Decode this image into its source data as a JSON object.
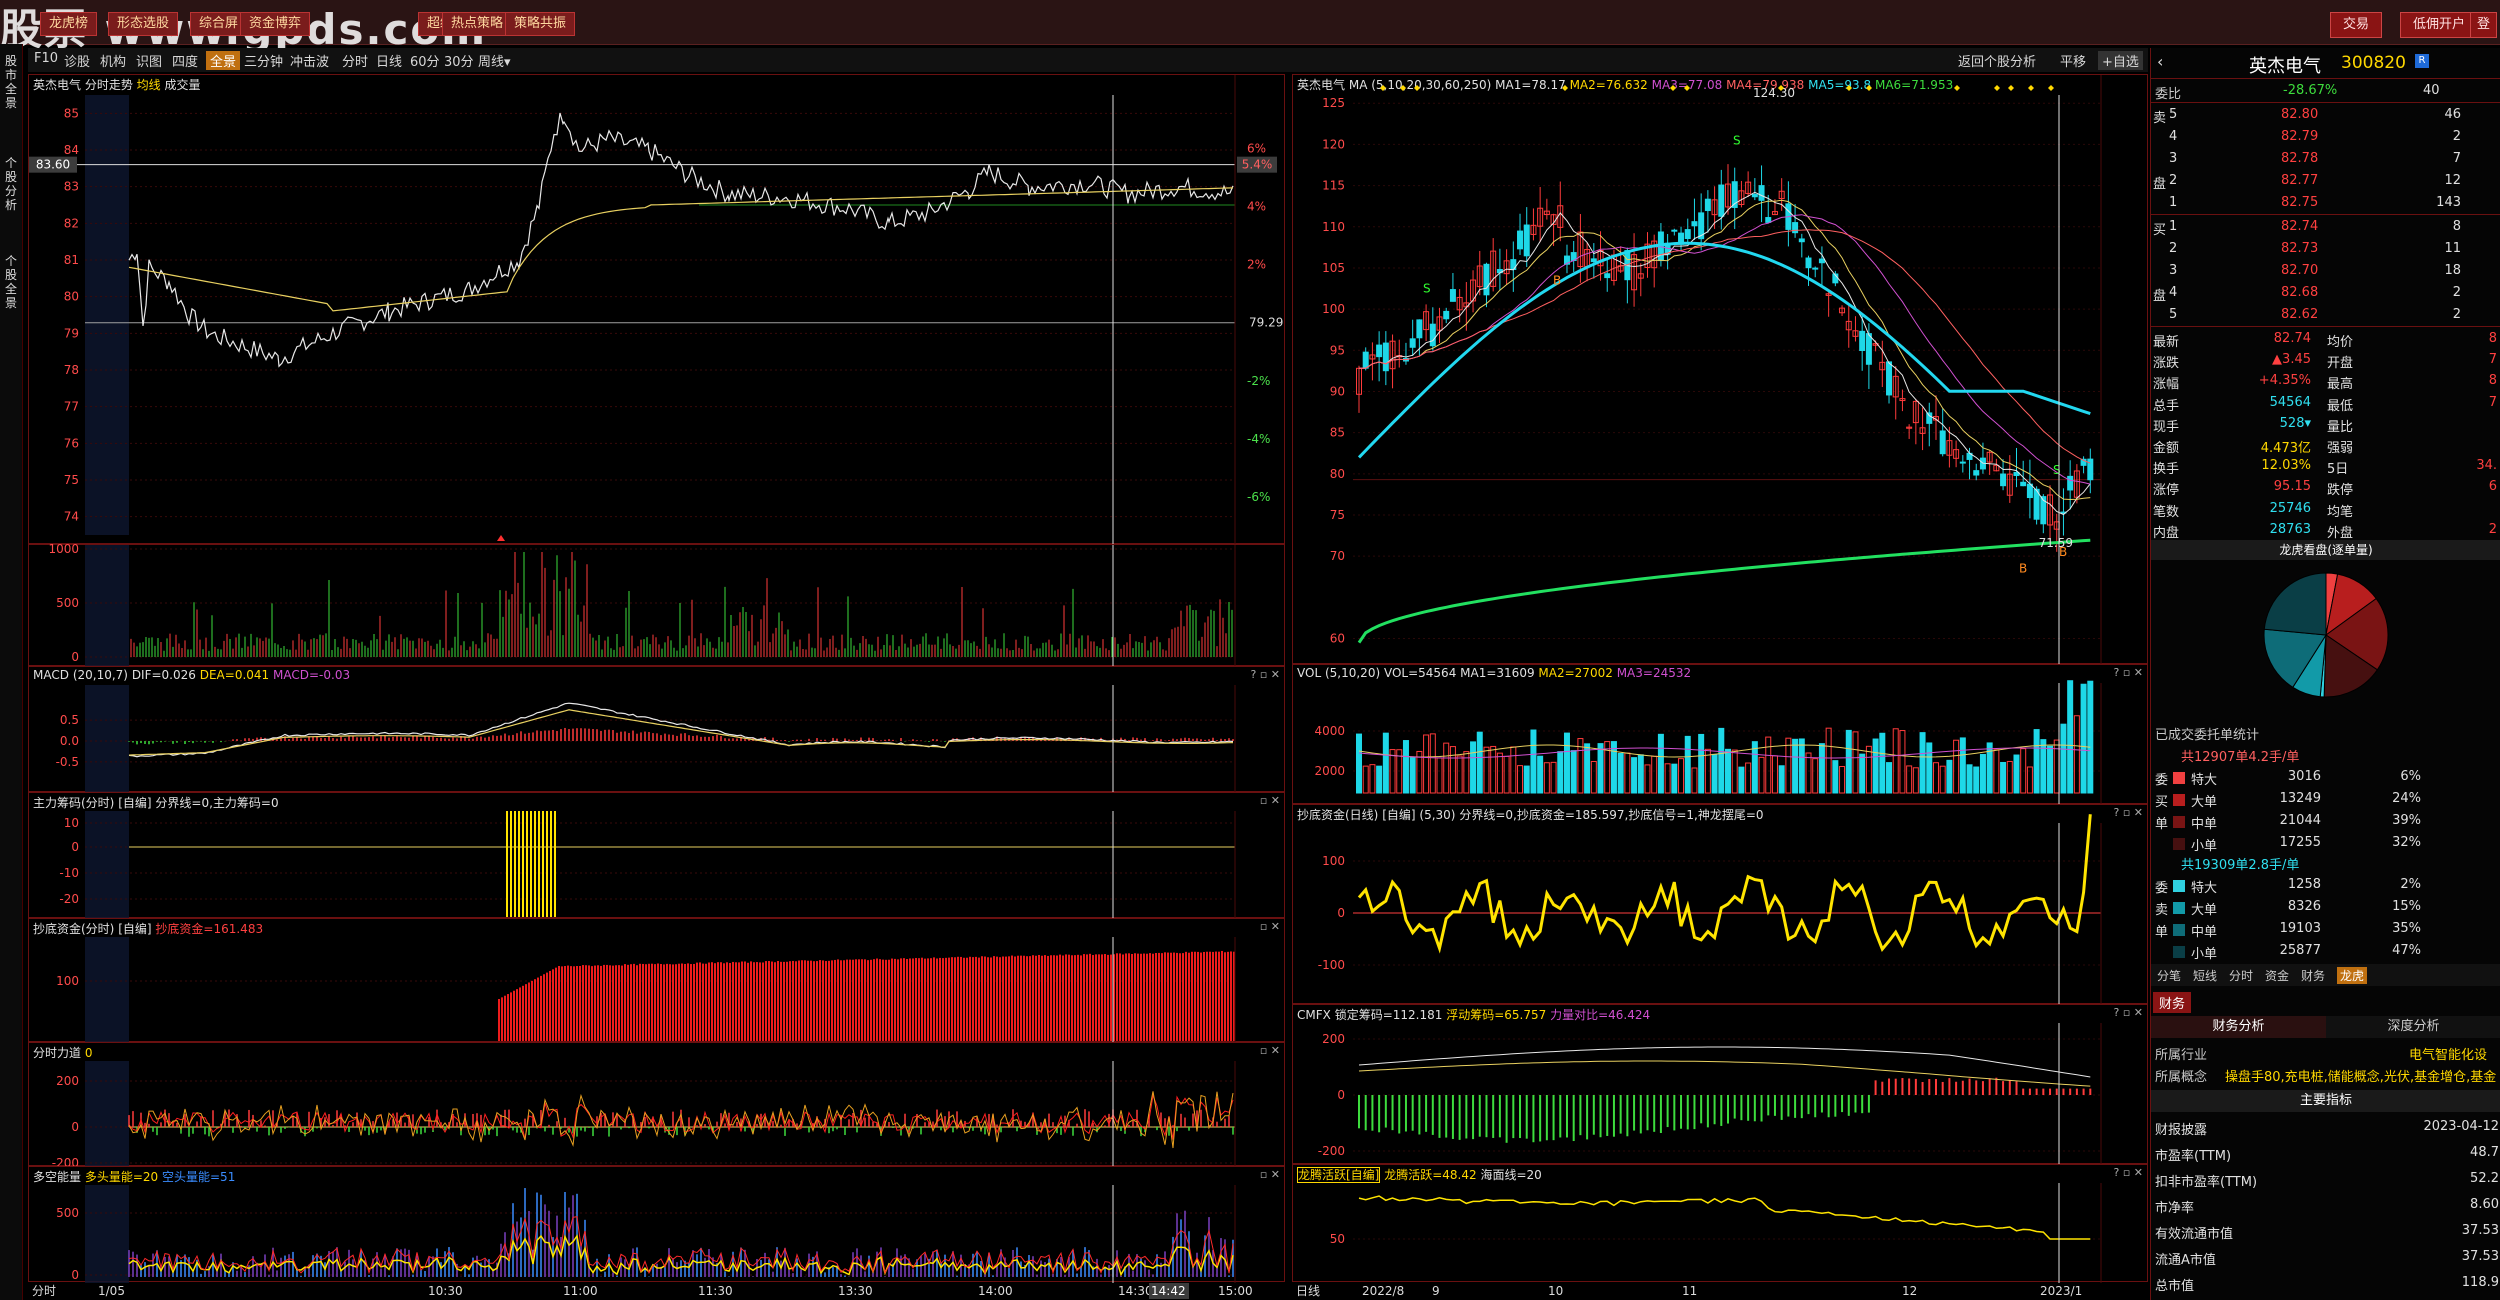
{
  "watermark": "股票 www.gpds.com",
  "top_buttons": [
    "龙虎榜",
    "形态选股",
    "综合屏",
    "资金博弈",
    "超级选股",
    "热点策略",
    "策略共振"
  ],
  "top_right": {
    "trade": "交易",
    "open_account": "低佣开户",
    "login": "登"
  },
  "side_tabs": [
    "股市全景",
    "个股分析",
    "个股全景"
  ],
  "toolbar": {
    "left": [
      "F10",
      "诊股",
      "机构",
      "识图",
      "四度",
      "全景",
      "三分钟",
      "冲击波",
      "分时",
      "日线",
      "60分",
      "30分",
      "周线▾"
    ],
    "active": "全景",
    "right": {
      "back": "返回个股分析",
      "flat": "平移",
      "self_select": "+自选"
    }
  },
  "intraday": {
    "title": "英杰电气  分时走势",
    "avg_label": "均线",
    "vol_label": "成交量",
    "price_ticks": [
      "85",
      "84",
      "83",
      "82",
      "81",
      "80",
      "79",
      "78",
      "77",
      "76",
      "75",
      "74"
    ],
    "pct_ticks": [
      "6%",
      "4%",
      "2%",
      "-2%",
      "-4%",
      "-6%"
    ],
    "pct_zero": "79.29",
    "current_price": "83.60",
    "current_pct": "5.4%",
    "vol_ticks": [
      "1000",
      "500",
      "0"
    ],
    "time_ticks": [
      "分时",
      "1/05",
      "10:30",
      "11:00",
      "11:30",
      "13:30",
      "14:00",
      "14:30",
      "14:42",
      "15:00"
    ],
    "cursor_time": "14:42",
    "macd": {
      "name": "MACD",
      "params": "(20,10,7)",
      "dif": "DIF=0.026",
      "dea": "DEA=0.041",
      "macd": "MACD=-0.03"
    },
    "macd_ticks": [
      "0.5",
      "0.0",
      "-0.5"
    ],
    "main_force": {
      "name": "主力筹码(分时)",
      "custom": "[自编]",
      "text": "分界线=0,主力筹码=0",
      "ticks": [
        "10",
        "0",
        "-10",
        "-20"
      ]
    },
    "bottom_fund": {
      "name": "抄底资金(分时)",
      "custom": "[自编]",
      "text": "抄底资金=161.483",
      "ticks": [
        "100"
      ]
    },
    "force": {
      "name": "分时力道",
      "value": "0",
      "ticks": [
        "200",
        "0",
        "-200"
      ]
    },
    "energy": {
      "name": "多空能量",
      "long": "多头量能=20",
      "short": "空头量能=51",
      "ticks": [
        "500",
        "0"
      ]
    }
  },
  "kline": {
    "title": "英杰电气",
    "ma_label": "MA",
    "ma_params": "(5,10,20,30,60,250)",
    "ma_values": [
      "MA1=78.17",
      "MA2=76.632",
      "MA3=77.08",
      "MA4=79.938",
      "MA5=93.8",
      "MA6=71.953"
    ],
    "price_ticks": [
      "125",
      "120",
      "115",
      "110",
      "105",
      "100",
      "95",
      "90",
      "85",
      "80",
      "75",
      "70",
      "60"
    ],
    "high_mark": "124.30",
    "low_mark": "71.59",
    "vol": {
      "name": "VOL",
      "params": "(5,10,20)",
      "values": [
        "VOL=54564",
        "MA1=31609",
        "MA2=27002",
        "MA3=24532"
      ],
      "ticks": [
        "4000",
        "2000"
      ]
    },
    "bottom_fund": {
      "name": "抄底资金(日线)",
      "custom": "[自编]",
      "params": "(5,30)",
      "text": "分界线=0,抄底资金=185.597,抄底信号=1,神龙摆尾=0",
      "ticks": [
        "100",
        "0",
        "-100"
      ]
    },
    "cmfx": {
      "name": "CMFX",
      "values": [
        "锁定筹码=112.181",
        "浮动筹码=65.757",
        "力量对比=46.424"
      ],
      "ticks": [
        "200",
        "0",
        "-200"
      ]
    },
    "dragon": {
      "name": "龙腾活跃[自编]",
      "text": "龙腾活跃=48.42",
      "sea": "海面线=20",
      "ticks": [
        "50"
      ]
    },
    "date_ticks": [
      "日线",
      "2022/8",
      "9",
      "10",
      "11",
      "12",
      "2023/1"
    ]
  },
  "quote": {
    "name": "英杰电气",
    "code": "300820",
    "ratio_label": "委比",
    "ratio_value": "-28.67%",
    "ratio_count": "40",
    "asks": [
      {
        "side": "卖",
        "n": "5",
        "price": "82.80",
        "vol": "46"
      },
      {
        "side": "",
        "n": "4",
        "price": "82.79",
        "vol": "2"
      },
      {
        "side": "",
        "n": "3",
        "price": "82.78",
        "vol": "7"
      },
      {
        "side": "盘",
        "n": "2",
        "price": "82.77",
        "vol": "12"
      },
      {
        "side": "",
        "n": "1",
        "price": "82.75",
        "vol": "143"
      }
    ],
    "bids": [
      {
        "side": "买",
        "n": "1",
        "price": "82.74",
        "vol": "8"
      },
      {
        "side": "",
        "n": "2",
        "price": "82.73",
        "vol": "11"
      },
      {
        "side": "",
        "n": "3",
        "price": "82.70",
        "vol": "18"
      },
      {
        "side": "盘",
        "n": "4",
        "price": "82.68",
        "vol": "2"
      },
      {
        "side": "",
        "n": "5",
        "price": "82.62",
        "vol": "2"
      }
    ],
    "stats_left": [
      {
        "k": "最新",
        "v": "82.74"
      },
      {
        "k": "涨跌",
        "v": "▲3.45"
      },
      {
        "k": "涨幅",
        "v": "+4.35%"
      },
      {
        "k": "总手",
        "v": "54564"
      },
      {
        "k": "现手",
        "v": "528▾"
      },
      {
        "k": "金额",
        "v": "4.473亿"
      },
      {
        "k": "换手",
        "v": "12.03%"
      },
      {
        "k": "涨停",
        "v": "95.15"
      },
      {
        "k": "笔数",
        "v": "25746"
      },
      {
        "k": "内盘",
        "v": "28763"
      }
    ],
    "stats_right": [
      {
        "k": "均价",
        "v": "8"
      },
      {
        "k": "开盘",
        "v": "7"
      },
      {
        "k": "最高",
        "v": "8"
      },
      {
        "k": "最低",
        "v": "7"
      },
      {
        "k": "量比",
        "v": ""
      },
      {
        "k": "强弱",
        "v": ""
      },
      {
        "k": "5日",
        "v": "34."
      },
      {
        "k": "跌停",
        "v": "6"
      },
      {
        "k": "均笔",
        "v": ""
      },
      {
        "k": "外盘",
        "v": "2"
      }
    ],
    "dragon_title": "龙虎看盘(逐单量)",
    "pie_slices": [
      {
        "pct": 6,
        "color": "#f04040"
      },
      {
        "pct": 24,
        "color": "#b81e1e"
      },
      {
        "pct": 39,
        "color": "#7a1414"
      },
      {
        "pct": 32,
        "color": "#461010"
      },
      {
        "pct": 2,
        "color": "#30d0e0"
      },
      {
        "pct": 15,
        "color": "#129aa8"
      },
      {
        "pct": 35,
        "color": "#0e6c78"
      },
      {
        "pct": 47,
        "color": "#0a3e46"
      }
    ],
    "deal_title": "已成交委托单统计",
    "buy_summary": "共12907单4.2手/单",
    "buy_rows": [
      {
        "side": "委",
        "label": "特大",
        "vol": "3016",
        "pct": "6%",
        "color": "#f04040"
      },
      {
        "side": "买",
        "label": "大单",
        "vol": "13249",
        "pct": "24%",
        "color": "#b81e1e"
      },
      {
        "side": "单",
        "label": "中单",
        "vol": "21044",
        "pct": "39%",
        "color": "#7a1414"
      },
      {
        "side": "",
        "label": "小单",
        "vol": "17255",
        "pct": "32%",
        "color": "#461010"
      }
    ],
    "sell_summary": "共19309单2.8手/单",
    "sell_rows": [
      {
        "side": "委",
        "label": "特大",
        "vol": "1258",
        "pct": "2%",
        "color": "#30d0e0"
      },
      {
        "side": "卖",
        "label": "大单",
        "vol": "8326",
        "pct": "15%",
        "color": "#129aa8"
      },
      {
        "side": "单",
        "label": "中单",
        "vol": "19103",
        "pct": "35%",
        "color": "#0e6c78"
      },
      {
        "side": "",
        "label": "小单",
        "vol": "25877",
        "pct": "47%",
        "color": "#0a3e46"
      }
    ],
    "bottom_tabs": [
      "分笔",
      "短线",
      "分时",
      "资金",
      "财务",
      "龙虎"
    ],
    "fin_tab": "财务",
    "fin_subtabs": [
      "财务分析",
      "深度分析"
    ],
    "industry_label": "所属行业",
    "industry_value": "电气智能化设",
    "concept_label": "所属概念",
    "concept_value": "操盘手80,充电桩,储能概念,光伏,基金增仓,基金",
    "main_index": "主要指标",
    "fin_rows": [
      {
        "k": "财报披露",
        "v": "2023-04-12"
      },
      {
        "k": "市盈率(TTM)",
        "v": "48.7"
      },
      {
        "k": "扣非市盈率(TTM)",
        "v": "52.2"
      },
      {
        "k": "市净率",
        "v": "8.60"
      },
      {
        "k": "有效流通市值",
        "v": "37.53"
      },
      {
        "k": "流通A市值",
        "v": "37.53"
      },
      {
        "k": "总市值",
        "v": "118.9"
      }
    ]
  }
}
